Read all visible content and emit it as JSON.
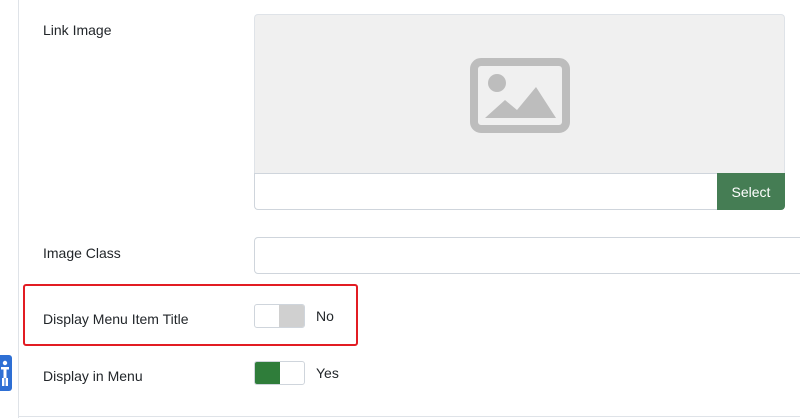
{
  "fields": {
    "link_image": {
      "label": "Link Image",
      "path_value": "",
      "select_label": "Select"
    },
    "image_class": {
      "label": "Image Class",
      "value": ""
    },
    "display_menu_item_title": {
      "label": "Display Menu Item Title",
      "state": "No"
    },
    "display_in_menu": {
      "label": "Display in Menu",
      "state": "Yes"
    }
  },
  "colors": {
    "select_button": "#457d54",
    "switch_on": "#2f7d3a",
    "switch_off": "#d0d0d0",
    "highlight": "#e21c23",
    "accessibility_badge": "#2e6fd4"
  },
  "icons": {
    "image_placeholder": "image-placeholder-icon",
    "accessibility": "accessibility-icon"
  }
}
